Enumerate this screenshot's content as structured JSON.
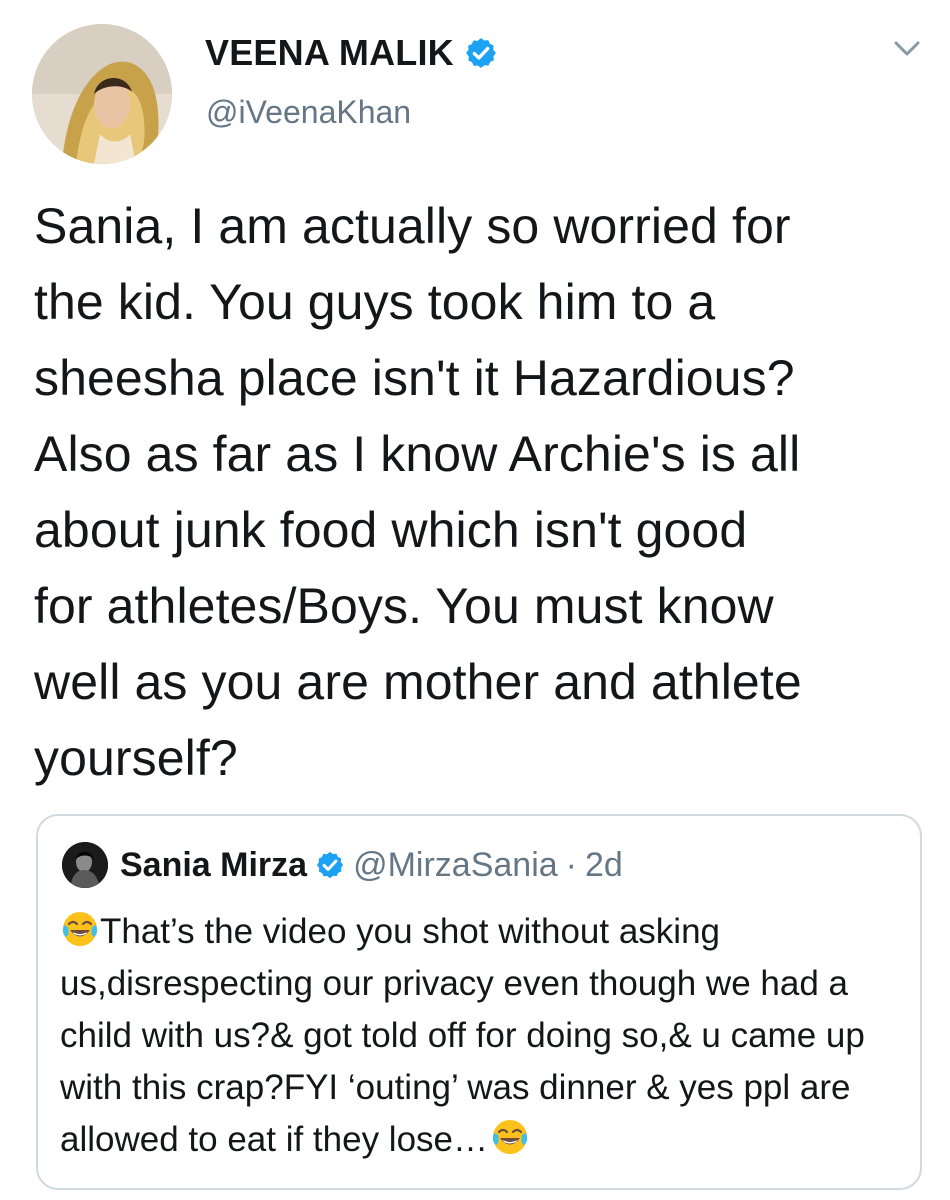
{
  "tweet": {
    "author": {
      "name": "VEENA MALIK",
      "handle": "@iVeenaKhan",
      "verified": true
    },
    "text": "Sania, I am actually so worried for\nthe kid. You guys took him to a\nsheesha place isn't it Hazardious?\nAlso as far as I know Archie's is all\nabout junk food which isn't good\nfor athletes/Boys. You must know\nwell as you are mother and athlete\nyourself?",
    "menu_icon": "chevron-down-icon"
  },
  "quoted_tweet": {
    "author": {
      "name": "Sania Mirza",
      "handle": "@MirzaSania",
      "verified": true
    },
    "separator": "·",
    "time": "2d",
    "leading_emoji": "face-with-tears-of-joy-emoji",
    "text": "That’s the video you shot without asking us,disrespecting our privacy even though we had a child with us?& got told off for doing so,& u came up with this crap?FYI ‘outing’ was dinner & yes ppl are allowed to eat if they lose…",
    "trailing_emoji": "face-with-tears-of-joy-emoji"
  },
  "colors": {
    "text_primary": "#14171a",
    "text_secondary": "#657786",
    "verified_blue": "#1da1f2",
    "card_border": "#cfd9de"
  }
}
